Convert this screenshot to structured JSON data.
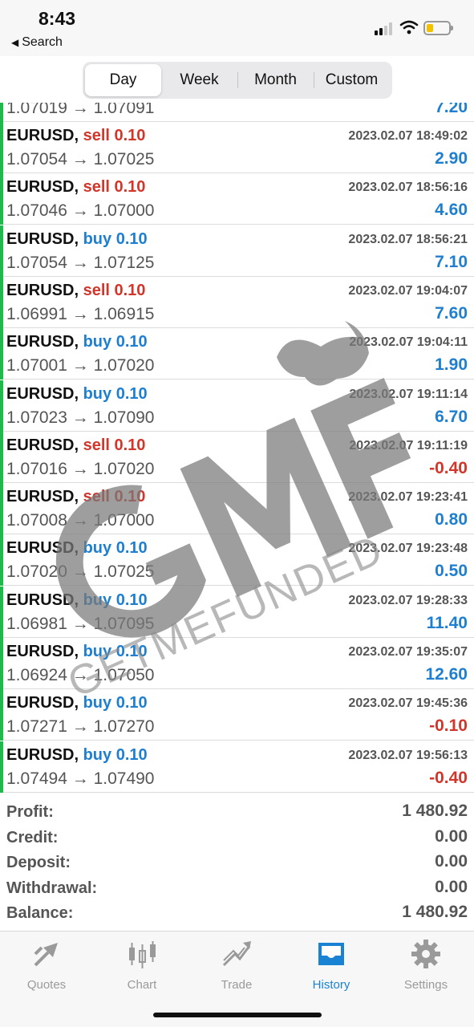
{
  "status_bar": {
    "time": "8:43",
    "back_label": "Search"
  },
  "segments": [
    {
      "label": "Day",
      "active": true
    },
    {
      "label": "Week",
      "active": false
    },
    {
      "label": "Month",
      "active": false
    },
    {
      "label": "Custom",
      "active": false
    }
  ],
  "partial_deal": {
    "prices": "1.07019 → 1.07091",
    "profit": "7.20"
  },
  "deals": [
    {
      "symbol": "EURUSD,",
      "side": "sell",
      "volume": "0.10",
      "prices": "1.07054 → 1.07025",
      "datetime": "2023.02.07 18:49:02",
      "profit": "2.90",
      "profit_sign": "pos"
    },
    {
      "symbol": "EURUSD,",
      "side": "sell",
      "volume": "0.10",
      "prices": "1.07046 → 1.07000",
      "datetime": "2023.02.07 18:56:16",
      "profit": "4.60",
      "profit_sign": "pos"
    },
    {
      "symbol": "EURUSD,",
      "side": "buy",
      "volume": "0.10",
      "prices": "1.07054 → 1.07125",
      "datetime": "2023.02.07 18:56:21",
      "profit": "7.10",
      "profit_sign": "pos"
    },
    {
      "symbol": "EURUSD,",
      "side": "sell",
      "volume": "0.10",
      "prices": "1.06991 → 1.06915",
      "datetime": "2023.02.07 19:04:07",
      "profit": "7.60",
      "profit_sign": "pos"
    },
    {
      "symbol": "EURUSD,",
      "side": "buy",
      "volume": "0.10",
      "prices": "1.07001 → 1.07020",
      "datetime": "2023.02.07 19:04:11",
      "profit": "1.90",
      "profit_sign": "pos"
    },
    {
      "symbol": "EURUSD,",
      "side": "buy",
      "volume": "0.10",
      "prices": "1.07023 → 1.07090",
      "datetime": "2023.02.07 19:11:14",
      "profit": "6.70",
      "profit_sign": "pos"
    },
    {
      "symbol": "EURUSD,",
      "side": "sell",
      "volume": "0.10",
      "prices": "1.07016 → 1.07020",
      "datetime": "2023.02.07 19:11:19",
      "profit": "-0.40",
      "profit_sign": "neg"
    },
    {
      "symbol": "EURUSD,",
      "side": "sell",
      "volume": "0.10",
      "prices": "1.07008 → 1.07000",
      "datetime": "2023.02.07 19:23:41",
      "profit": "0.80",
      "profit_sign": "pos"
    },
    {
      "symbol": "EURUSD,",
      "side": "buy",
      "volume": "0.10",
      "prices": "1.07020 → 1.07025",
      "datetime": "2023.02.07 19:23:48",
      "profit": "0.50",
      "profit_sign": "pos"
    },
    {
      "symbol": "EURUSD,",
      "side": "buy",
      "volume": "0.10",
      "prices": "1.06981 → 1.07095",
      "datetime": "2023.02.07 19:28:33",
      "profit": "11.40",
      "profit_sign": "pos"
    },
    {
      "symbol": "EURUSD,",
      "side": "buy",
      "volume": "0.10",
      "prices": "1.06924 → 1.07050",
      "datetime": "2023.02.07 19:35:07",
      "profit": "12.60",
      "profit_sign": "pos"
    },
    {
      "symbol": "EURUSD,",
      "side": "buy",
      "volume": "0.10",
      "prices": "1.07271 → 1.07270",
      "datetime": "2023.02.07 19:45:36",
      "profit": "-0.10",
      "profit_sign": "neg"
    },
    {
      "symbol": "EURUSD,",
      "side": "buy",
      "volume": "0.10",
      "prices": "1.07494 → 1.07490",
      "datetime": "2023.02.07 19:56:13",
      "profit": "-0.40",
      "profit_sign": "neg"
    }
  ],
  "watermark": {
    "logo_text": "GMF",
    "tagline": "GETMEFUNDED"
  },
  "summary": [
    {
      "label": "Profit:",
      "value": "1 480.92"
    },
    {
      "label": "Credit:",
      "value": "0.00"
    },
    {
      "label": "Deposit:",
      "value": "0.00"
    },
    {
      "label": "Withdrawal:",
      "value": "0.00"
    },
    {
      "label": "Balance:",
      "value": "1 480.92"
    }
  ],
  "tabbar": [
    {
      "label": "Quotes",
      "icon": "quotes-icon",
      "active": false
    },
    {
      "label": "Chart",
      "icon": "chart-icon",
      "active": false
    },
    {
      "label": "Trade",
      "icon": "trade-icon",
      "active": false
    },
    {
      "label": "History",
      "icon": "history-icon",
      "active": true
    },
    {
      "label": "Settings",
      "icon": "gear-icon",
      "active": false
    }
  ],
  "colors": {
    "sell": "#d2362a",
    "buy": "#1e7fd0",
    "accent": "#1a82d3",
    "deal_bar": "#1fb84a"
  }
}
